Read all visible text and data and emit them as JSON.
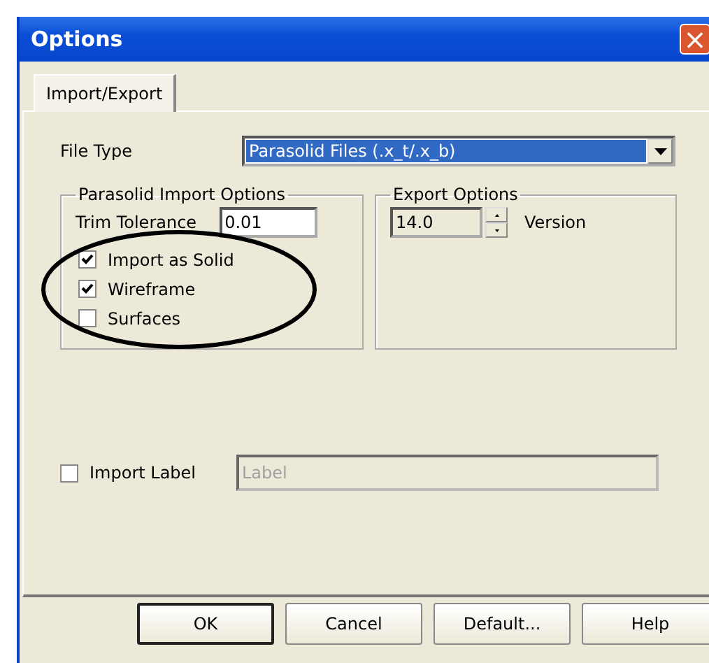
{
  "window": {
    "title": "Options",
    "close": "×"
  },
  "tabs": [
    {
      "label": "Import/Export",
      "selected": true
    }
  ],
  "file_type": {
    "label": "File Type",
    "value": "Parasolid Files (.x_t/.x_b)"
  },
  "import_group": {
    "title": "Parasolid Import Options",
    "trim_label": "Trim Tolerance",
    "trim_value": "0.01",
    "options": [
      {
        "label": "Import as Solid",
        "checked": true
      },
      {
        "label": "Wireframe",
        "checked": true
      },
      {
        "label": "Surfaces",
        "checked": false
      }
    ]
  },
  "export_group": {
    "title": "Export Options",
    "version_value": "14.0",
    "version_label": "Version"
  },
  "import_label": {
    "label": "Import Label",
    "checked": false,
    "field_value": "Label",
    "disabled": true
  },
  "buttons": [
    {
      "label": "OK",
      "default": true
    },
    {
      "label": "Cancel",
      "default": false
    },
    {
      "label": "Default...",
      "default": false
    },
    {
      "label": "Help",
      "default": false
    }
  ]
}
